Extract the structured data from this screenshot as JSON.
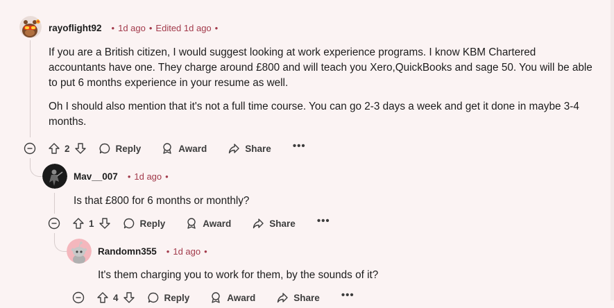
{
  "comments": [
    {
      "username": "rayoflight92",
      "time": "1d ago",
      "edited": "Edited 1d ago",
      "paragraphs": [
        "If you are a British citizen, I would suggest looking at work experience programs. I know KBM Chartered accountants have one. They charge around £800 and will teach you Xero,QuickBooks and sage 50. You will be able to put 6 months experience in your resume as well.",
        "Oh I should also mention that it's not a full time course. You can go 2-3 days a week and get it done in maybe 3-4 months."
      ],
      "votes": "2",
      "reply_label": "Reply",
      "award_label": "Award",
      "share_label": "Share",
      "more_label": "•••"
    },
    {
      "username": "Mav__007",
      "time": "1d ago",
      "paragraphs": [
        "Is that £800 for 6 months or monthly?"
      ],
      "votes": "1",
      "reply_label": "Reply",
      "award_label": "Award",
      "share_label": "Share",
      "more_label": "•••"
    },
    {
      "username": "Randomn355",
      "time": "1d ago",
      "paragraphs": [
        "It's them charging you to work for them, by the sounds of it?"
      ],
      "votes": "4",
      "reply_label": "Reply",
      "award_label": "Award",
      "share_label": "Share",
      "more_label": "•••"
    }
  ],
  "colors": {
    "meta": "#a23a4b",
    "thread_line": "#d6cccc",
    "background": "#fbf3f3"
  }
}
